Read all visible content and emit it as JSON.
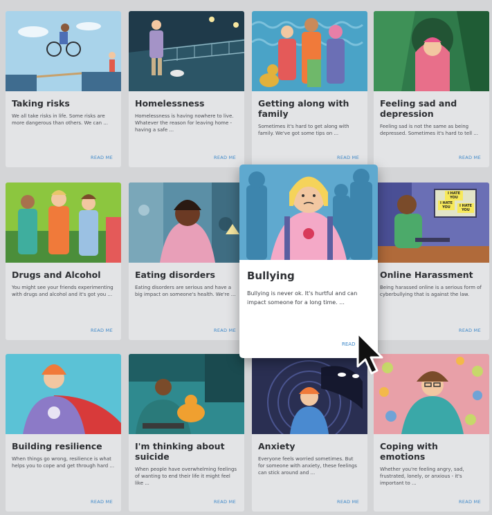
{
  "read_more_label": "READ ME",
  "featured_read_label": "READ",
  "cards": [
    {
      "title": "Taking risks",
      "text": "We all take risks in life. Some risks are more dangerous than others. We can ..."
    },
    {
      "title": "Homelessness",
      "text": "Homelessness is having nowhere to live. Whatever the reason for leaving home - having a safe ..."
    },
    {
      "title": "Getting along with family",
      "text": "Sometimes it's hard to get along with family. We've got some tips on ..."
    },
    {
      "title": "Feeling sad and depression",
      "text": "Feeling sad is not the same as being depressed. Sometimes it's hard to tell ..."
    },
    {
      "title": "Drugs and Alcohol",
      "text": "You might see your friends experimenting with drugs and alcohol and it's got you ..."
    },
    {
      "title": "Eating disorders",
      "text": "Eating disorders are serious and have a big impact on someone's health. We're ..."
    },
    {
      "title": "Online Harassment",
      "text": "Being harassed online is a serious form of cyberbullying that is against the law."
    },
    {
      "title": "Building resilience",
      "text": "When things go wrong, resilience is what helps you to cope and get through hard ..."
    },
    {
      "title": "I'm thinking about suicide",
      "text": "When people have overwhelming feelings of wanting to end their life it might feel like ..."
    },
    {
      "title": "Anxiety",
      "text": "Everyone feels worried sometimes. But for someone with anxiety, these feelings can stick around and ..."
    },
    {
      "title": "Coping with emotions",
      "text": "Whether you're feeling angry, sad, frustrated, lonely, or anxious - it's important to ..."
    }
  ],
  "featured": {
    "title": "Bullying",
    "text": "Bullying is never ok. It's hurtful and can impact someone for a long time. ..."
  },
  "screen_signs": [
    "I HATE YOU",
    "I HATE YOU",
    "I HATE YOU"
  ]
}
